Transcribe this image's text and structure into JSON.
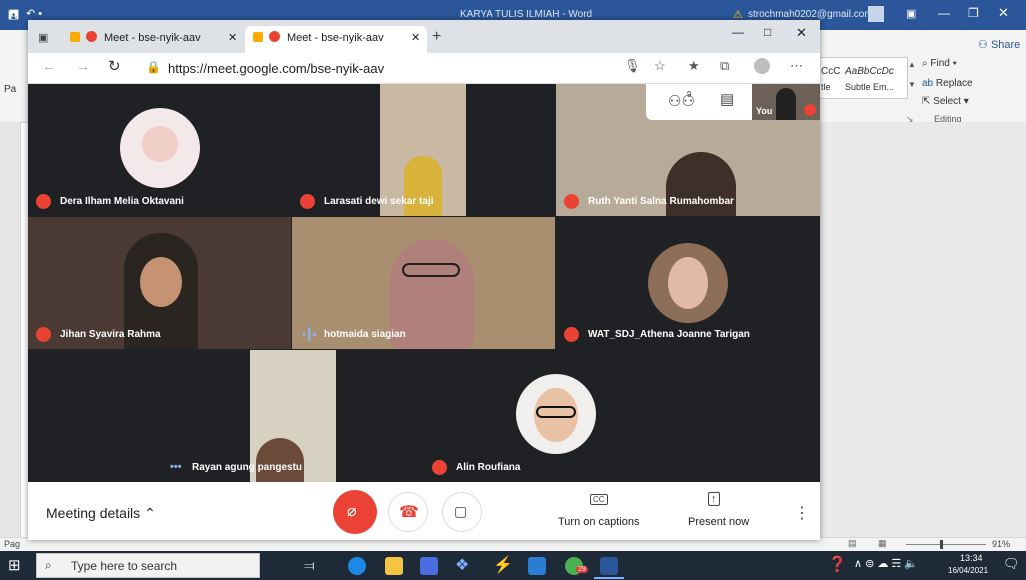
{
  "word": {
    "title": "KARYA TULIS ILMIAH  -  Word",
    "account": "strochmah0202@gmail.com",
    "share": "Share",
    "find": "Find",
    "replace": "Replace",
    "select": "Select",
    "editing": "Editing",
    "style1": "AaBbCcDc",
    "style1_name": "Subtle Em...",
    "style_prefix": "CcC",
    "style_prefix2": "tle",
    "page_label": "Pag",
    "zoom": "91%"
  },
  "browser": {
    "tabs": [
      {
        "label": "Meet - bse-nyik-aav",
        "active": false
      },
      {
        "label": "Meet - bse-nyik-aav",
        "active": true
      }
    ],
    "new_tab": "+",
    "url_prefix": "https://",
    "url_host": "meet.google.com",
    "url_path": "/bse-nyik-aav"
  },
  "meet": {
    "participant_count": "9",
    "self_label": "You",
    "participants": [
      {
        "name": "Dera Ilham Melia Oktavani",
        "status": "muted"
      },
      {
        "name": "Larasati dewi sekar taji",
        "status": "muted"
      },
      {
        "name": "Ruth Yanti Salna Rumahombar",
        "status": "muted"
      },
      {
        "name": "Jihan Syavira Rahma",
        "status": "muted"
      },
      {
        "name": "hotmaida siagian",
        "status": "speaking"
      },
      {
        "name": "WAT_SDJ_Athena Joanne Tarigan",
        "status": "muted"
      },
      {
        "name": "Rayan agung pangestu",
        "status": "more"
      },
      {
        "name": "Alin Roufiana",
        "status": "muted"
      }
    ],
    "meeting_details": "Meeting details",
    "captions_label": "Turn on captions",
    "present_label": "Present now",
    "captions_icon": "CC"
  },
  "taskbar": {
    "search_placeholder": "Type here to search",
    "time": "13:34",
    "date": "16/04/2021",
    "badge": "29",
    "notifications": "2"
  },
  "colors": {
    "word_blue": "#2b579a",
    "meet_red": "#ea4335",
    "tile_bg": "#3c4043"
  }
}
